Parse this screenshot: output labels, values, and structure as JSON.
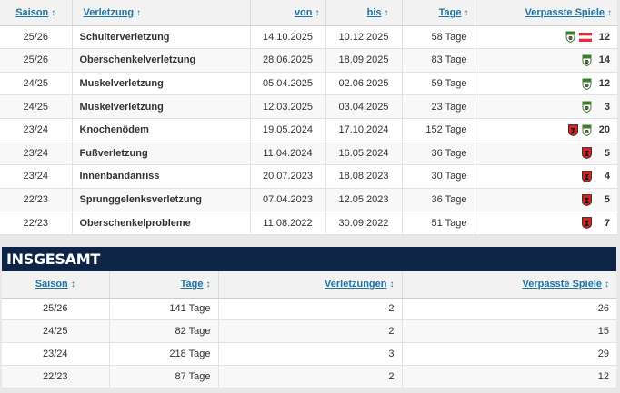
{
  "injuries": {
    "headers": {
      "season": "Saison",
      "injury": "Verletzung",
      "from": "von",
      "until": "bis",
      "days": "Tage",
      "missed": "Verpasste Spiele"
    },
    "sort_icon": "sort-arrows-icon",
    "rows": [
      {
        "season": "25/26",
        "injury": "Schulterverletzung",
        "from": "14.10.2025",
        "until": "10.12.2025",
        "days": "58 Tage",
        "games": "12",
        "crests": [
          "rapid-wien-crest-icon",
          "austria-flag-icon"
        ]
      },
      {
        "season": "25/26",
        "injury": "Oberschenkelverletzung",
        "from": "28.06.2025",
        "until": "18.09.2025",
        "days": "83 Tage",
        "games": "14",
        "crests": [
          "rapid-wien-crest-icon"
        ]
      },
      {
        "season": "24/25",
        "injury": "Muskelverletzung",
        "from": "05.04.2025",
        "until": "02.06.2025",
        "days": "59 Tage",
        "games": "12",
        "crests": [
          "rapid-wien-crest-icon"
        ]
      },
      {
        "season": "24/25",
        "injury": "Muskelverletzung",
        "from": "12.03.2025",
        "until": "03.04.2025",
        "days": "23 Tage",
        "games": "3",
        "crests": [
          "rapid-wien-crest-icon"
        ]
      },
      {
        "season": "23/24",
        "injury": "Knochenödem",
        "from": "19.05.2024",
        "until": "17.10.2024",
        "days": "152 Tage",
        "games": "20",
        "crests": [
          "red-club-crest-icon",
          "rapid-wien-crest-icon"
        ]
      },
      {
        "season": "23/24",
        "injury": "Fußverletzung",
        "from": "11.04.2024",
        "until": "16.05.2024",
        "days": "36 Tage",
        "games": "5",
        "crests": [
          "red-club-crest-icon"
        ]
      },
      {
        "season": "23/24",
        "injury": "Innenbandanriss",
        "from": "20.07.2023",
        "until": "18.08.2023",
        "days": "30 Tage",
        "games": "4",
        "crests": [
          "red-club-crest-icon"
        ]
      },
      {
        "season": "22/23",
        "injury": "Sprunggelenksverletzung",
        "from": "07.04.2023",
        "until": "12.05.2023",
        "days": "36 Tage",
        "games": "5",
        "crests": [
          "red-club-crest-icon"
        ]
      },
      {
        "season": "22/23",
        "injury": "Oberschenkelprobleme",
        "from": "11.08.2022",
        "until": "30.09.2022",
        "days": "51 Tage",
        "games": "7",
        "crests": [
          "red-club-crest-icon"
        ]
      }
    ]
  },
  "totals": {
    "title": "INSGESAMT",
    "headers": {
      "season": "Saison",
      "days": "Tage",
      "injuries": "Verletzungen",
      "missed": "Verpasste Spiele"
    },
    "rows": [
      {
        "season": "25/26",
        "days": "141 Tage",
        "injuries": "2",
        "games": "26"
      },
      {
        "season": "24/25",
        "days": "82 Tage",
        "injuries": "2",
        "games": "15"
      },
      {
        "season": "23/24",
        "days": "218 Tage",
        "injuries": "3",
        "games": "29"
      },
      {
        "season": "22/23",
        "days": "87 Tage",
        "injuries": "2",
        "games": "12"
      }
    ]
  },
  "colors": {
    "link": "#1d75a3",
    "totals_bar": "#0e2447",
    "rapid_green": "#3f7d2e",
    "red_club": "#d2231e",
    "austria_red": "#ed2939"
  }
}
